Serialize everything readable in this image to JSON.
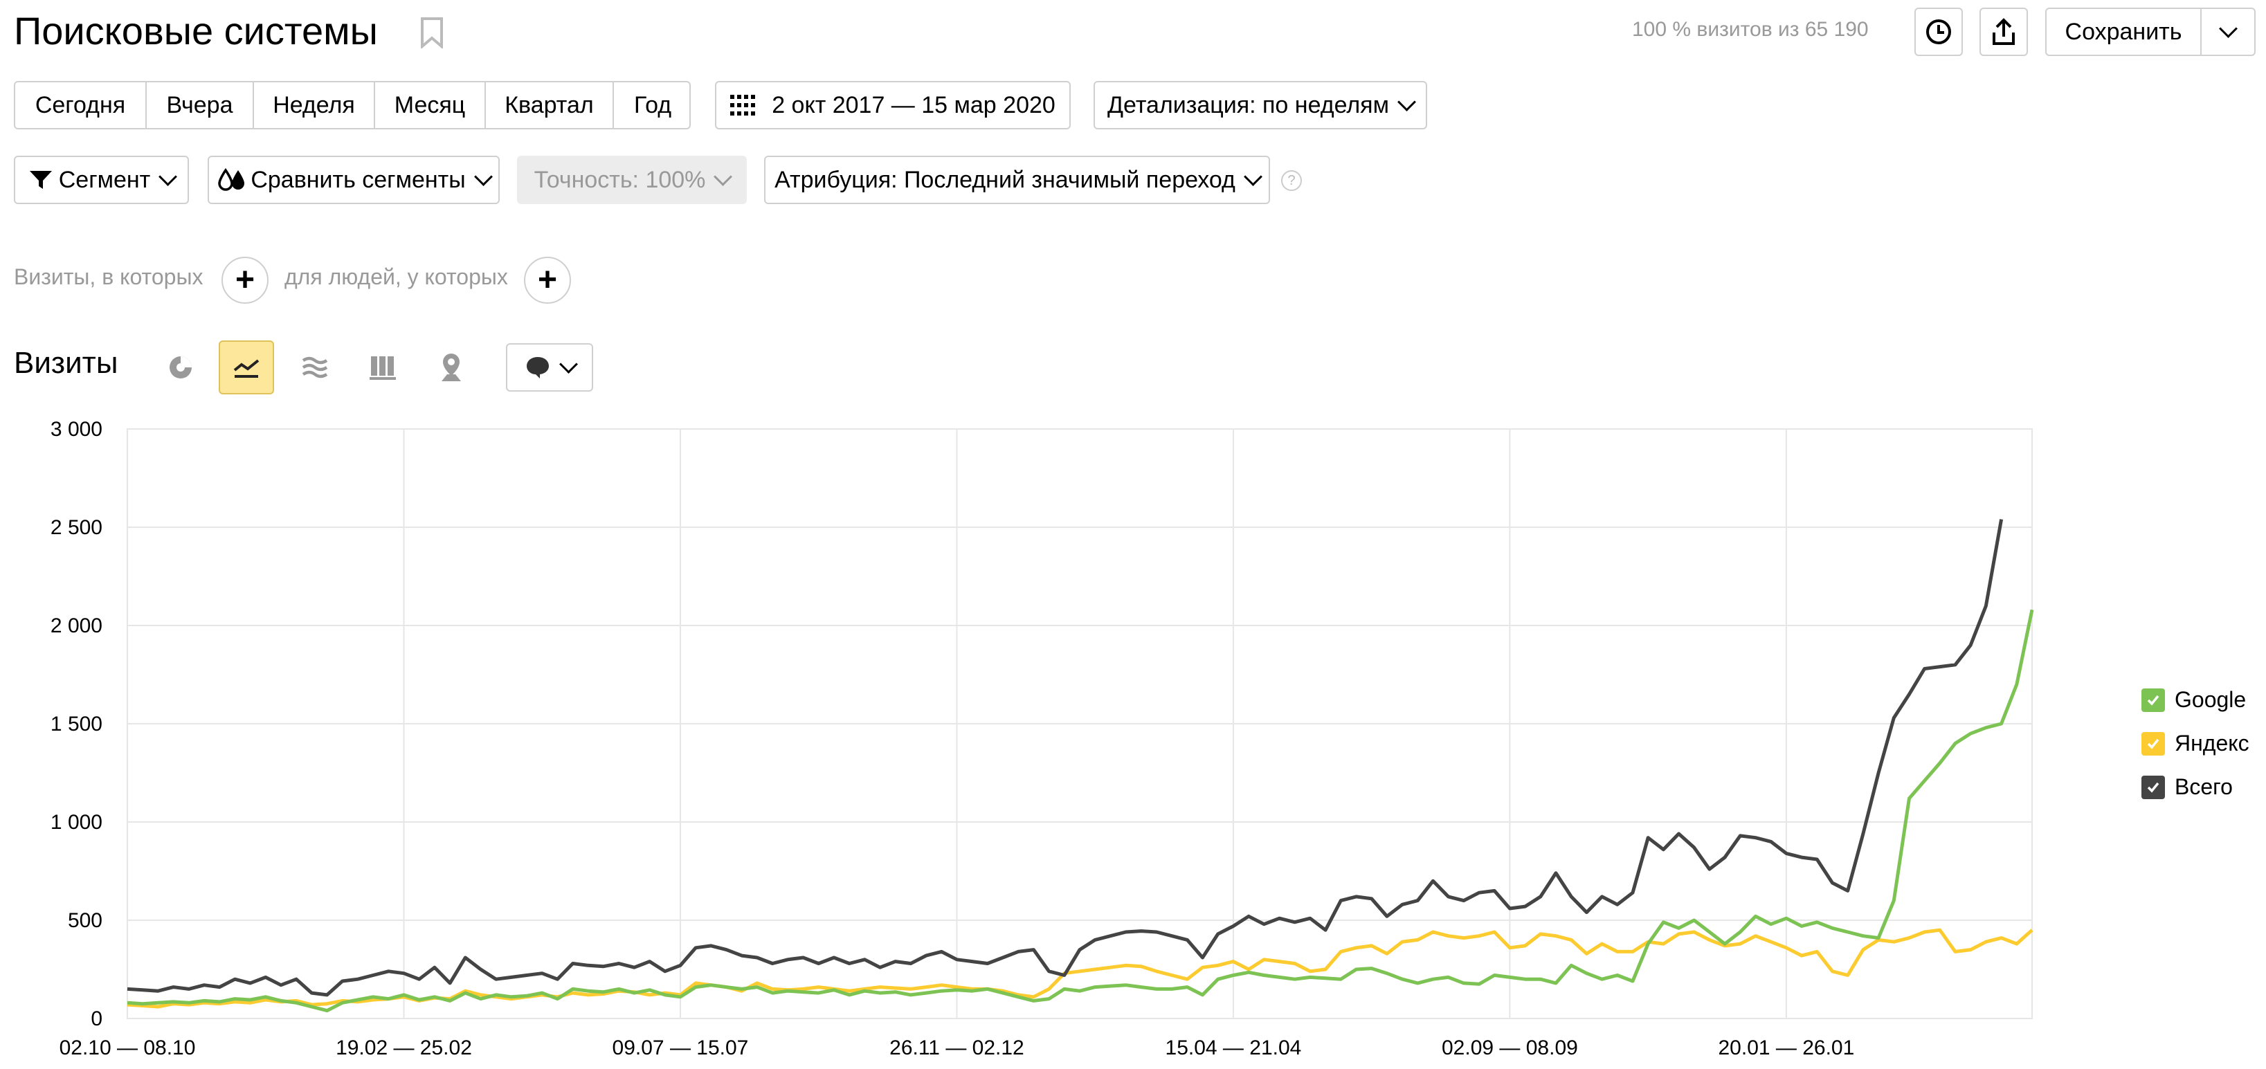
{
  "header": {
    "title": "Поисковые системы",
    "visits_summary": "100 % визитов из 65 190",
    "save_label": "Сохранить"
  },
  "periods": [
    "Сегодня",
    "Вчера",
    "Неделя",
    "Месяц",
    "Квартал",
    "Год"
  ],
  "date_range": "2 окт 2017 — 15 мар 2020",
  "detail": "Детализация: по неделям",
  "filters": {
    "segment": "Сегмент",
    "compare": "Сравнить сегменты",
    "accuracy": "Точность: 100%",
    "attribution": "Атрибуция: Последний значимый переход",
    "help": "?"
  },
  "conditions": {
    "visits_where": "Визиты, в которых",
    "people_where": "для людей, у которых"
  },
  "chart_section": {
    "metric": "Визиты"
  },
  "colors": {
    "google": "#7dc354",
    "yandex": "#fccb2f",
    "total": "#444444",
    "selected_bg": "#fde79a",
    "grid": "#e6e6e6"
  },
  "chart_data": {
    "type": "line",
    "x_tick_labels": [
      "02.10 — 08.10",
      "19.02 — 25.02",
      "09.07 — 15.07",
      "26.11 — 02.12",
      "15.04 — 21.04",
      "02.09 — 08.09",
      "20.01 — 26.01"
    ],
    "y_ticks": [
      "0",
      "500",
      "1 000",
      "1 500",
      "2 000",
      "2 500",
      "3 000"
    ],
    "ylim": [
      0,
      3000
    ],
    "legend_position": "right",
    "grid": true,
    "series": [
      {
        "name": "Google",
        "color": "#7dc354",
        "values": [
          80,
          75,
          80,
          85,
          80,
          90,
          85,
          100,
          95,
          110,
          90,
          80,
          60,
          40,
          80,
          95,
          110,
          100,
          120,
          95,
          110,
          90,
          130,
          100,
          120,
          110,
          115,
          130,
          100,
          150,
          140,
          135,
          150,
          130,
          145,
          120,
          110,
          160,
          170,
          160,
          150,
          160,
          130,
          140,
          135,
          130,
          145,
          120,
          140,
          130,
          135,
          120,
          130,
          140,
          145,
          140,
          150,
          130,
          110,
          90,
          100,
          150,
          140,
          160,
          165,
          170,
          160,
          150,
          150,
          160,
          120,
          200,
          220,
          235,
          220,
          210,
          200,
          210,
          205,
          200,
          250,
          255,
          230,
          200,
          180,
          200,
          210,
          180,
          175,
          220,
          210,
          200,
          200,
          180,
          270,
          230,
          200,
          220,
          190,
          380,
          490,
          460,
          500,
          440,
          380,
          440,
          520,
          480,
          510,
          470,
          490,
          460,
          440,
          420,
          410,
          600,
          1120,
          1210,
          1300,
          1400,
          1450,
          1480,
          1500,
          1700,
          2080
        ]
      },
      {
        "name": "Яндекс",
        "color": "#fccb2f",
        "values": [
          70,
          65,
          60,
          75,
          70,
          80,
          75,
          85,
          80,
          95,
          85,
          90,
          70,
          75,
          90,
          85,
          95,
          100,
          110,
          90,
          105,
          100,
          140,
          120,
          110,
          100,
          110,
          120,
          110,
          130,
          120,
          125,
          140,
          135,
          120,
          130,
          120,
          180,
          170,
          160,
          140,
          180,
          150,
          145,
          150,
          160,
          150,
          140,
          150,
          160,
          155,
          150,
          160,
          170,
          160,
          150,
          150,
          140,
          120,
          110,
          150,
          230,
          240,
          250,
          260,
          270,
          265,
          240,
          220,
          200,
          260,
          270,
          290,
          250,
          300,
          290,
          280,
          240,
          250,
          340,
          360,
          370,
          330,
          390,
          400,
          440,
          420,
          410,
          420,
          440,
          360,
          370,
          430,
          420,
          400,
          330,
          380,
          340,
          340,
          390,
          380,
          430,
          440,
          400,
          370,
          380,
          420,
          390,
          360,
          320,
          340,
          240,
          220,
          350,
          400,
          390,
          410,
          440,
          450,
          340,
          350,
          390,
          410,
          380,
          450
        ]
      },
      {
        "name": "Всего",
        "color": "#444444",
        "values": [
          150,
          145,
          140,
          160,
          150,
          170,
          160,
          200,
          180,
          210,
          170,
          200,
          130,
          120,
          190,
          200,
          220,
          240,
          230,
          200,
          260,
          180,
          310,
          250,
          200,
          210,
          220,
          230,
          200,
          280,
          270,
          265,
          280,
          260,
          290,
          240,
          270,
          360,
          370,
          350,
          320,
          310,
          280,
          300,
          310,
          280,
          310,
          280,
          300,
          260,
          290,
          280,
          320,
          340,
          300,
          290,
          280,
          310,
          340,
          350,
          240,
          220,
          350,
          400,
          420,
          440,
          445,
          440,
          420,
          400,
          310,
          430,
          470,
          520,
          480,
          510,
          490,
          510,
          450,
          600,
          620,
          610,
          520,
          580,
          600,
          700,
          620,
          600,
          640,
          650,
          560,
          570,
          620,
          740,
          620,
          540,
          620,
          580,
          640,
          920,
          860,
          940,
          870,
          760,
          820,
          930,
          920,
          900,
          840,
          820,
          810,
          690,
          650,
          940,
          1250,
          1530,
          1650,
          1780,
          1790,
          1800,
          1900,
          2100,
          2540
        ]
      }
    ]
  }
}
